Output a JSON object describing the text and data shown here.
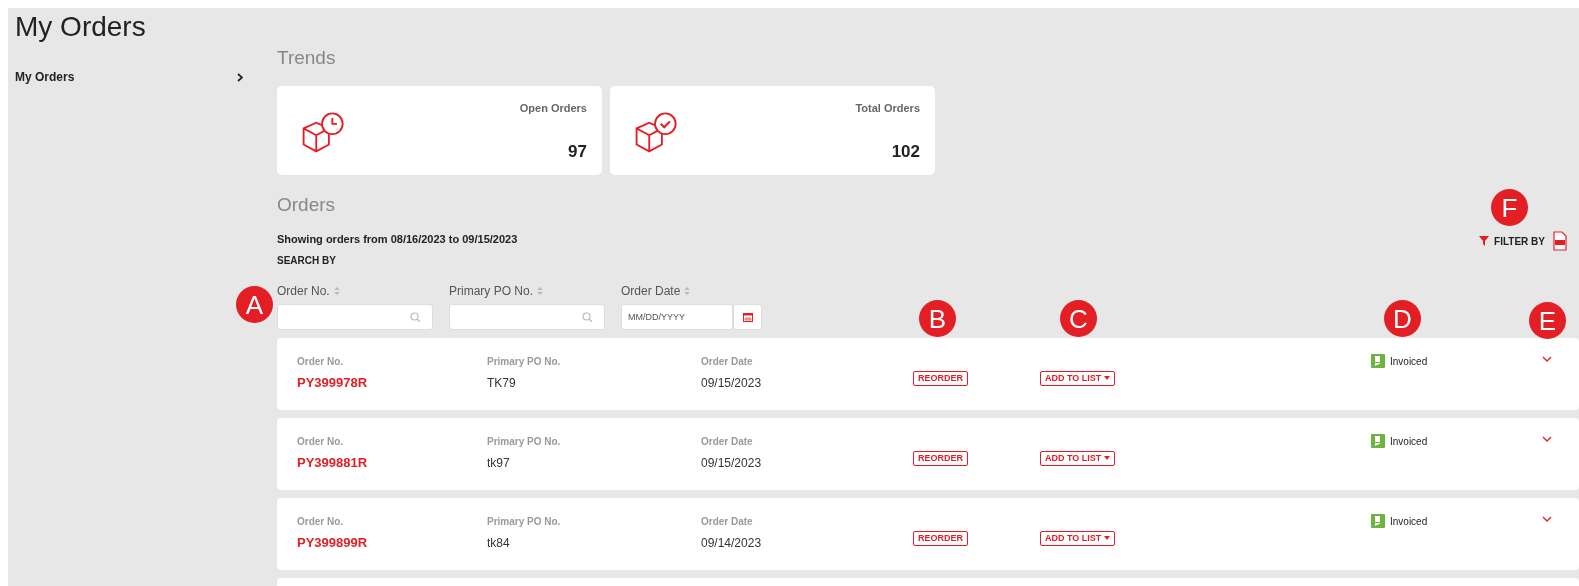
{
  "page_title": "My Orders",
  "sidebar": {
    "items": [
      {
        "label": "My Orders"
      }
    ]
  },
  "trends": {
    "title": "Trends",
    "cards": [
      {
        "kind": "open",
        "label": "Open Orders",
        "value": "97"
      },
      {
        "kind": "total",
        "label": "Total Orders",
        "value": "102"
      }
    ]
  },
  "orders": {
    "title": "Orders",
    "range_text": "Showing orders from 08/16/2023 to 09/15/2023",
    "search_by": "SEARCH BY",
    "filter_label": "FILTER BY",
    "filters": [
      {
        "kind": "search",
        "label": "Order No."
      },
      {
        "kind": "search",
        "label": "Primary PO No."
      },
      {
        "kind": "date",
        "label": "Order Date",
        "placeholder": "MM/DD/YYYY"
      }
    ],
    "rows": [
      {
        "order_no_label": "Order No.",
        "order_no": "PY399978R",
        "po_label": "Primary PO No.",
        "po": "TK79",
        "date_label": "Order Date",
        "date": "09/15/2023",
        "reorder": "REORDER",
        "add_to_list": "ADD TO LIST",
        "status": "Invoiced"
      },
      {
        "order_no_label": "Order No.",
        "order_no": "PY399881R",
        "po_label": "Primary PO No.",
        "po": "tk97",
        "date_label": "Order Date",
        "date": "09/15/2023",
        "reorder": "REORDER",
        "add_to_list": "ADD TO LIST",
        "status": "Invoiced"
      },
      {
        "order_no_label": "Order No.",
        "order_no": "PY399899R",
        "po_label": "Primary PO No.",
        "po": "tk84",
        "date_label": "Order Date",
        "date": "09/14/2023",
        "reorder": "REORDER",
        "add_to_list": "ADD TO LIST",
        "status": "Invoiced"
      }
    ]
  },
  "callouts": [
    {
      "letter": "A"
    },
    {
      "letter": "B"
    },
    {
      "letter": "C"
    },
    {
      "letter": "D"
    },
    {
      "letter": "E"
    },
    {
      "letter": "F"
    }
  ]
}
